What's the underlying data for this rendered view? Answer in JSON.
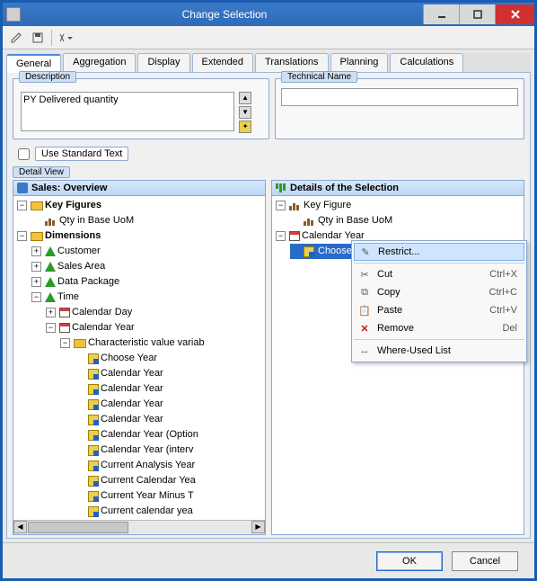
{
  "window": {
    "title": "Change Selection"
  },
  "tabs": [
    "General",
    "Aggregation",
    "Display",
    "Extended",
    "Translations",
    "Planning",
    "Calculations"
  ],
  "sections": {
    "description": {
      "label": "Description",
      "value": "PY Delivered quantity"
    },
    "technical": {
      "label": "Technical Name",
      "value": ""
    },
    "useStd": {
      "label": "Use Standard Text"
    },
    "detailView": {
      "label": "Detail View"
    }
  },
  "leftPanel": {
    "title": "Sales: Overview",
    "tree": {
      "keyFigures": {
        "label": "Key Figures",
        "children": [
          {
            "label": "Qty in Base UoM"
          }
        ]
      },
      "dimensions": {
        "label": "Dimensions",
        "children": [
          {
            "label": "Customer"
          },
          {
            "label": "Sales Area"
          },
          {
            "label": "Data Package"
          },
          {
            "label": "Time",
            "expanded": true,
            "children": [
              {
                "label": "Calendar Day"
              },
              {
                "label": "Calendar Year",
                "expanded": true,
                "children": [
                  {
                    "label": "Characteristic value variab",
                    "expanded": true,
                    "children": [
                      {
                        "label": "Choose Year"
                      },
                      {
                        "label": "Calendar Year"
                      },
                      {
                        "label": "Calendar Year"
                      },
                      {
                        "label": "Calendar Year"
                      },
                      {
                        "label": "Calendar Year"
                      },
                      {
                        "label": "Calendar Year (Option"
                      },
                      {
                        "label": "Calendar Year (interv"
                      },
                      {
                        "label": "Current Analysis Year"
                      },
                      {
                        "label": "Current Calendar Yea"
                      },
                      {
                        "label": "Current Year Minus T"
                      },
                      {
                        "label": "Current calendar yea"
                      }
                    ]
                  }
                ]
              }
            ]
          }
        ]
      }
    }
  },
  "rightPanel": {
    "title": "Details of the Selection",
    "items": [
      {
        "label": "Key Figure",
        "child": "Qty in Base UoM",
        "icon": "kf"
      },
      {
        "label": "Calendar Year",
        "child": "Choose Y",
        "childSelected": true,
        "icon": "cal"
      }
    ]
  },
  "contextMenu": {
    "items": [
      {
        "label": "Restrict...",
        "icon": "restrict",
        "hover": true
      },
      {
        "label": "Cut",
        "shortcut": "Ctrl+X",
        "icon": "cut"
      },
      {
        "label": "Copy",
        "shortcut": "Ctrl+C",
        "icon": "copy"
      },
      {
        "label": "Paste",
        "shortcut": "Ctrl+V",
        "icon": "paste"
      },
      {
        "label": "Remove",
        "shortcut": "Del",
        "icon": "remove"
      },
      {
        "label": "Where-Used List",
        "icon": "where"
      }
    ]
  },
  "buttons": {
    "ok": "OK",
    "cancel": "Cancel"
  }
}
